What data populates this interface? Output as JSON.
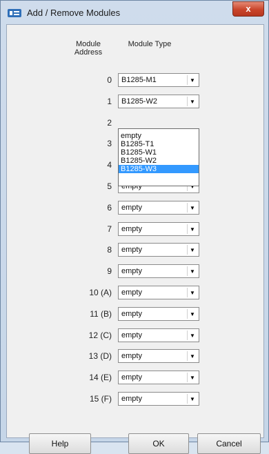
{
  "window": {
    "title": "Add / Remove Modules",
    "close_label": "x"
  },
  "headers": {
    "address": "Module Address",
    "type": "Module Type"
  },
  "rows": [
    {
      "address": "0",
      "type": "B1285-M1"
    },
    {
      "address": "1",
      "type": "B1285-W2"
    },
    {
      "address": "2",
      "type": ""
    },
    {
      "address": "3",
      "type": ""
    },
    {
      "address": "4",
      "type": ""
    },
    {
      "address": "5",
      "type": "empty"
    },
    {
      "address": "6",
      "type": "empty"
    },
    {
      "address": "7",
      "type": "empty"
    },
    {
      "address": "8",
      "type": "empty"
    },
    {
      "address": "9",
      "type": "empty"
    },
    {
      "address": "10 (A)",
      "type": "empty"
    },
    {
      "address": "11 (B)",
      "type": "empty"
    },
    {
      "address": "12 (C)",
      "type": "empty"
    },
    {
      "address": "13 (D)",
      "type": "empty"
    },
    {
      "address": "14 (E)",
      "type": "empty"
    },
    {
      "address": "15 (F)",
      "type": "empty"
    }
  ],
  "dropdown": {
    "options": [
      "empty",
      "B1285-T1",
      "B1285-W1",
      "B1285-W2",
      "B1285-W3"
    ],
    "highlighted": "B1285-W3"
  },
  "buttons": {
    "help": "Help",
    "ok": "OK",
    "cancel": "Cancel"
  }
}
